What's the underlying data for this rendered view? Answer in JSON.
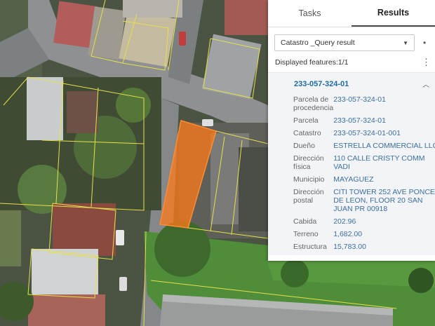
{
  "tabs": [
    {
      "label": "Tasks",
      "active": false
    },
    {
      "label": "Results",
      "active": true
    }
  ],
  "query_select": {
    "value": "Catastro _Query result"
  },
  "displayed_features": "Displayed features:1/1",
  "result": {
    "title": "233-057-324-01",
    "attributes": [
      {
        "key": "Parcela de procedencia",
        "value": "233-057-324-01"
      },
      {
        "key": "Parcela",
        "value": "233-057-324-01"
      },
      {
        "key": "Catastro",
        "value": "233-057-324-01-001"
      },
      {
        "key": "Dueño",
        "value": "ESTRELLA COMMERCIAL LLC"
      },
      {
        "key": "Dirección física",
        "value": "110 CALLE CRISTY COMM VADI"
      },
      {
        "key": "Municipio",
        "value": "MAYAGUEZ"
      },
      {
        "key": "Dirección postal",
        "value": "CITI TOWER 252 AVE PONCE DE LEON, FLOOR 20 SAN JUAN PR 00918"
      },
      {
        "key": "Cabida",
        "value": "202.96"
      },
      {
        "key": "Terreno",
        "value": "1,682.00"
      },
      {
        "key": "Estructura",
        "value": "15,783.00"
      }
    ]
  },
  "colors": {
    "accent": "#1f6aa5",
    "selection": "#ff7a1a",
    "parcel_lines": "#e6e04a"
  },
  "icons": {
    "caret": "chevron-down-icon",
    "collapse": "chevron-up-icon",
    "menu": "kebab-menu-icon"
  }
}
